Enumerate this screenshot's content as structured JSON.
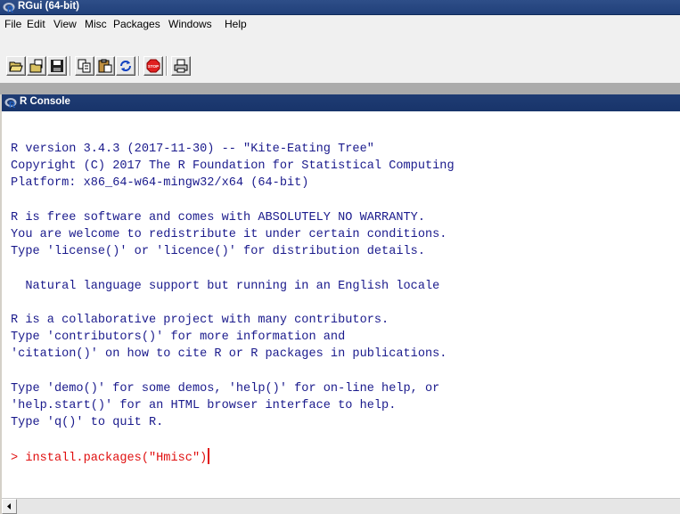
{
  "window": {
    "title": "RGui (64-bit)",
    "icon": "r-logo-icon"
  },
  "menu": [
    "File",
    "Edit",
    "View",
    "Misc",
    "Packages",
    "Windows",
    "Help"
  ],
  "toolbar": {
    "buttons": [
      "open-script-icon",
      "load-workspace-icon",
      "save-icon",
      "copy-icon",
      "paste-icon",
      "copy-paste-icon",
      "stop-icon",
      "print-icon"
    ],
    "stop_label": "STOP"
  },
  "console": {
    "title": "R Console",
    "lines": [
      "R version 3.4.3 (2017-11-30) -- \"Kite-Eating Tree\"",
      "Copyright (C) 2017 The R Foundation for Statistical Computing",
      "Platform: x86_64-w64-mingw32/x64 (64-bit)",
      "",
      "R is free software and comes with ABSOLUTELY NO WARRANTY.",
      "You are welcome to redistribute it under certain conditions.",
      "Type 'license()' or 'licence()' for distribution details.",
      "",
      "  Natural language support but running in an English locale",
      "",
      "R is a collaborative project with many contributors.",
      "Type 'contributors()' for more information and",
      "'citation()' on how to cite R or R packages in publications.",
      "",
      "Type 'demo()' for some demos, 'help()' for on-line help, or",
      "'help.start()' for an HTML browser interface to help.",
      "Type 'q()' to quit R.",
      ""
    ],
    "prompt": "> install.packages(\"Hmisc\")"
  },
  "colors": {
    "output": "#1a1a8c",
    "input": "#e01010",
    "titlebar": "#21407a"
  }
}
